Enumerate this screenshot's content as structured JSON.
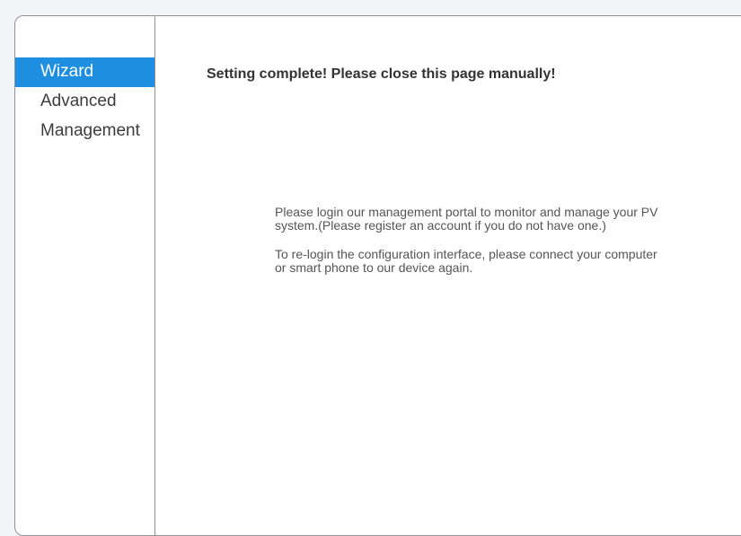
{
  "sidebar": {
    "items": [
      {
        "label": "Wizard",
        "active": true
      },
      {
        "label": "Advanced",
        "active": false
      },
      {
        "label": "Management",
        "active": false
      }
    ]
  },
  "main": {
    "heading": "Setting complete! Please close this page manually!",
    "paragraphs": [
      "Please login our management portal to monitor and manage your PV system.(Please register an account if you do not have one.)",
      "To re-login the configuration interface, please connect your computer or smart phone to our device again."
    ]
  },
  "colors": {
    "accent": "#1e8fe0",
    "border": "#8e9196",
    "text": "#333333"
  }
}
